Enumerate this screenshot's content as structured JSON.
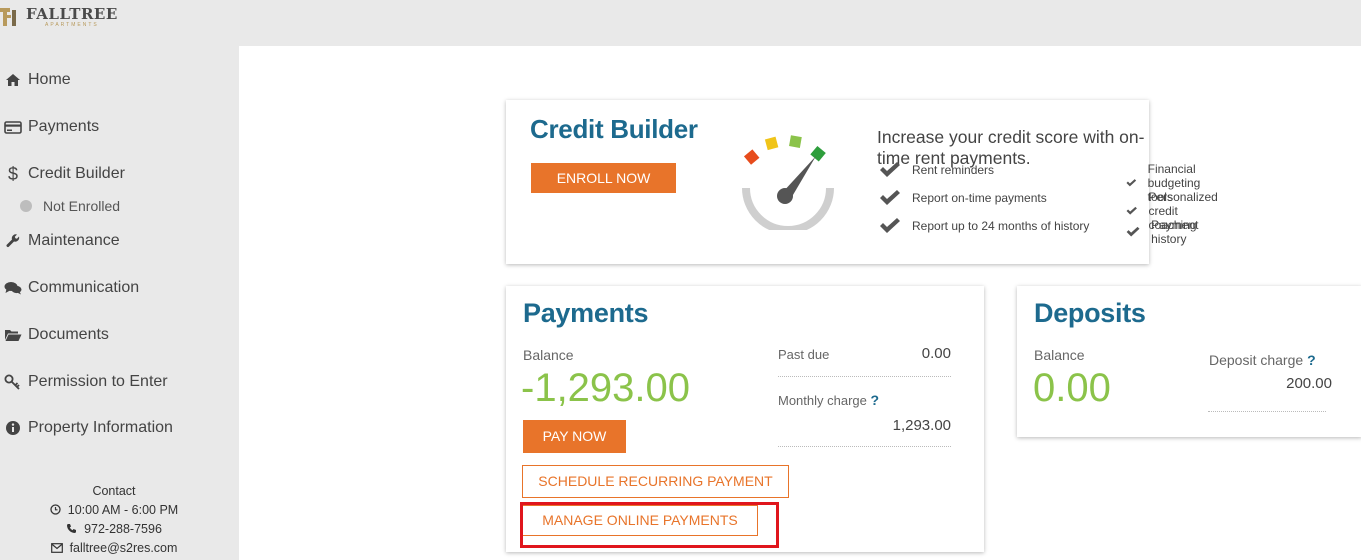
{
  "brand": {
    "name": "FALLTREE",
    "subtitle": "APARTMENTS",
    "gold": "#b89a5c"
  },
  "sidebar": {
    "items": [
      {
        "label": "Home",
        "icon": "home-icon"
      },
      {
        "label": "Payments",
        "icon": "credit-card-icon"
      },
      {
        "label": "Credit Builder",
        "icon": "dollar-icon"
      },
      {
        "label": "Maintenance",
        "icon": "wrench-icon"
      },
      {
        "label": "Communication",
        "icon": "chat-bubbles-icon"
      },
      {
        "label": "Documents",
        "icon": "folder-open-icon"
      },
      {
        "label": "Permission to Enter",
        "icon": "key-icon"
      },
      {
        "label": "Property Information",
        "icon": "info-circle-icon"
      }
    ],
    "credit_builder_status": "Not Enrolled",
    "contact": {
      "heading": "Contact",
      "hours": "10:00 AM - 6:00 PM",
      "phone": "972-288-7596",
      "email": "falltree@s2res.com"
    }
  },
  "credit_builder": {
    "title": "Credit Builder",
    "enroll_label": "ENROLL NOW",
    "headline": "Increase your credit score with on-time rent payments.",
    "features_left": [
      "Rent reminders",
      "Report on-time payments",
      "Report up to 24 months of history"
    ],
    "features_right": [
      "Financial budgeting tools",
      "Personalized credit coaching",
      "Payment history"
    ]
  },
  "payments": {
    "title": "Payments",
    "balance_label": "Balance",
    "balance": "-1,293.00",
    "past_due_label": "Past due",
    "past_due": "0.00",
    "monthly_charge_label": "Monthly charge",
    "monthly_charge": "1,293.00",
    "help_mark": "?",
    "pay_now_label": "PAY NOW",
    "schedule_label": "SCHEDULE RECURRING PAYMENT",
    "manage_label": "MANAGE ONLINE PAYMENTS"
  },
  "deposits": {
    "title": "Deposits",
    "balance_label": "Balance",
    "balance": "0.00",
    "deposit_charge_label": "Deposit charge",
    "deposit_charge": "200.00",
    "help_mark": "?"
  },
  "colors": {
    "accent_orange": "#e8742a",
    "title_blue": "#1d6a8e",
    "amount_green": "#8bc34a",
    "highlight_red": "#e0161c"
  }
}
